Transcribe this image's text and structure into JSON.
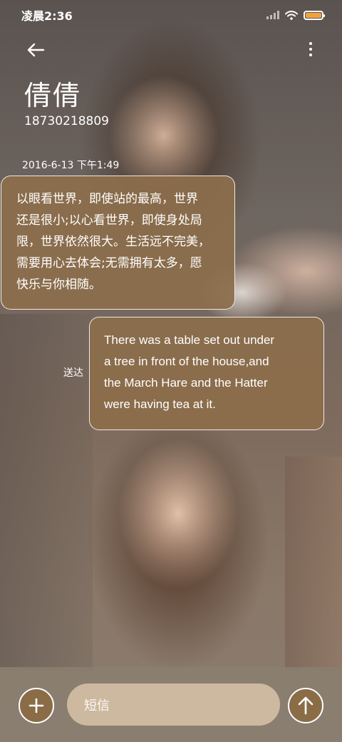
{
  "status_bar": {
    "time": "凌晨2:36",
    "battery_color": "#f2a23b"
  },
  "header": {
    "back_icon": "arrow-left-icon",
    "more_icon": "more-vertical-icon",
    "contact_name": "倩倩",
    "contact_number": "18730218809"
  },
  "conversation": {
    "timestamp": "2016-6-13 下午1:49",
    "messages": [
      {
        "direction": "incoming",
        "lines": [
          "以眼看世界，即使站的最高，世界",
          "还是很小;以心看世界，即使身处局",
          "限，世界依然很大。生活远不完美，",
          "需要用心去体会;无需拥有太多，愿",
          "快乐与你相随。"
        ]
      },
      {
        "direction": "outgoing",
        "status": "送达",
        "lines": [
          "There was a table set out under",
          "a tree in front of the house,and",
          "the March Hare and the Hatter",
          "were having tea at it."
        ]
      }
    ]
  },
  "composer": {
    "add_icon": "plus-icon",
    "placeholder": "短信",
    "send_icon": "arrow-up-icon",
    "accent_color": "#8a6c47"
  }
}
